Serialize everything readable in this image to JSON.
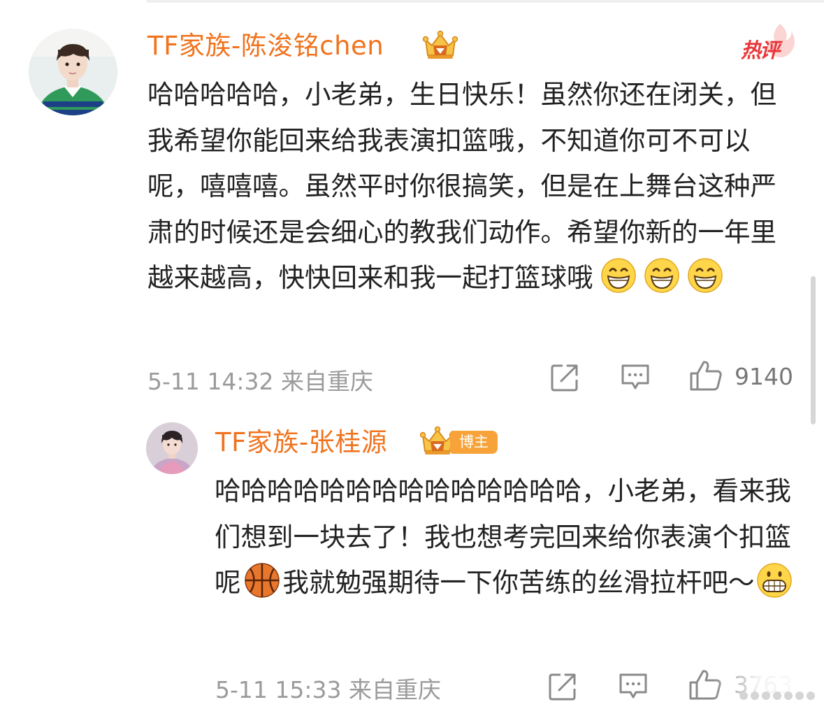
{
  "comments": [
    {
      "author": "TF家族-陈浚铭chen",
      "hot_badge": "热评",
      "text": "哈哈哈哈哈，小老弟，生日快乐！虽然你还在闭关，但我希望你能回来给我表演扣篮哦，不知道你可不可以呢，嘻嘻嘻。虽然平时你很搞笑，但是在上舞台这种严肃的时候还是会细心的教我们动作。希望你新的一年里越来越高，快快回来和我一起打篮球哦",
      "emojis": [
        "grin-emoji",
        "grin-emoji",
        "grin-emoji"
      ],
      "time": "5-11 14:32",
      "location": "来自重庆",
      "likes": "9140"
    },
    {
      "author": "TF家族-张桂源",
      "badge": "博主",
      "text_part1": "哈哈哈哈哈哈哈哈哈哈哈哈哈哈，小老弟，看来我们想到一块去了！我也想考完回来给你表演个扣篮呢",
      "text_part2": "我就勉强期待一下你苦练的丝滑拉杆吧～",
      "time": "5-11 15:33",
      "location": "来自重庆",
      "likes": "3763"
    }
  ],
  "colors": {
    "author_name": "#f0731e",
    "hot_badge": "#e8373a",
    "meta_text": "#9b9b9b",
    "blogger_badge": "#f7a33a"
  }
}
